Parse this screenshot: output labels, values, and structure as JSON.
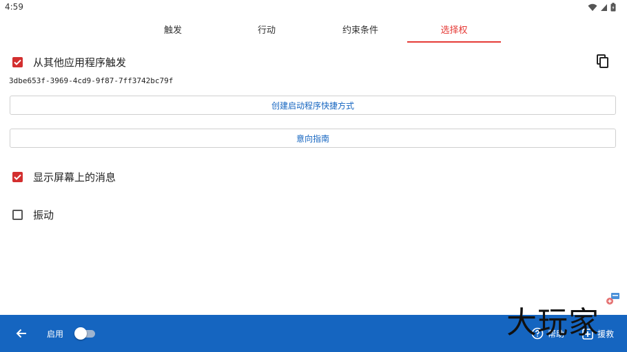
{
  "status_bar": {
    "time": "4:59"
  },
  "tabs": [
    {
      "label": "触发",
      "active": false
    },
    {
      "label": "行动",
      "active": false
    },
    {
      "label": "约束条件",
      "active": false
    },
    {
      "label": "选择权",
      "active": true
    }
  ],
  "trigger_from_other_apps": {
    "label": "从其他应用程序触发",
    "checked": true
  },
  "copy_icon": "content-copy-icon",
  "uuid": "3dbe653f-3969-4cd9-9f87-7ff3742bc79f",
  "buttons": {
    "create_shortcut": "创建启动程序快捷方式",
    "intent_guide": "意向指南"
  },
  "show_message": {
    "label": "显示屏幕上的消息",
    "checked": true
  },
  "vibrate": {
    "label": "振动",
    "checked": false
  },
  "bottom_bar": {
    "enable_label": "启用",
    "enabled": false,
    "help_label": "帮助",
    "rescue_label": "援救"
  },
  "watermark": "大玩家",
  "colors": {
    "accent": "#e53935",
    "checkbox": "#d32f2f",
    "primary": "#1565c0"
  }
}
